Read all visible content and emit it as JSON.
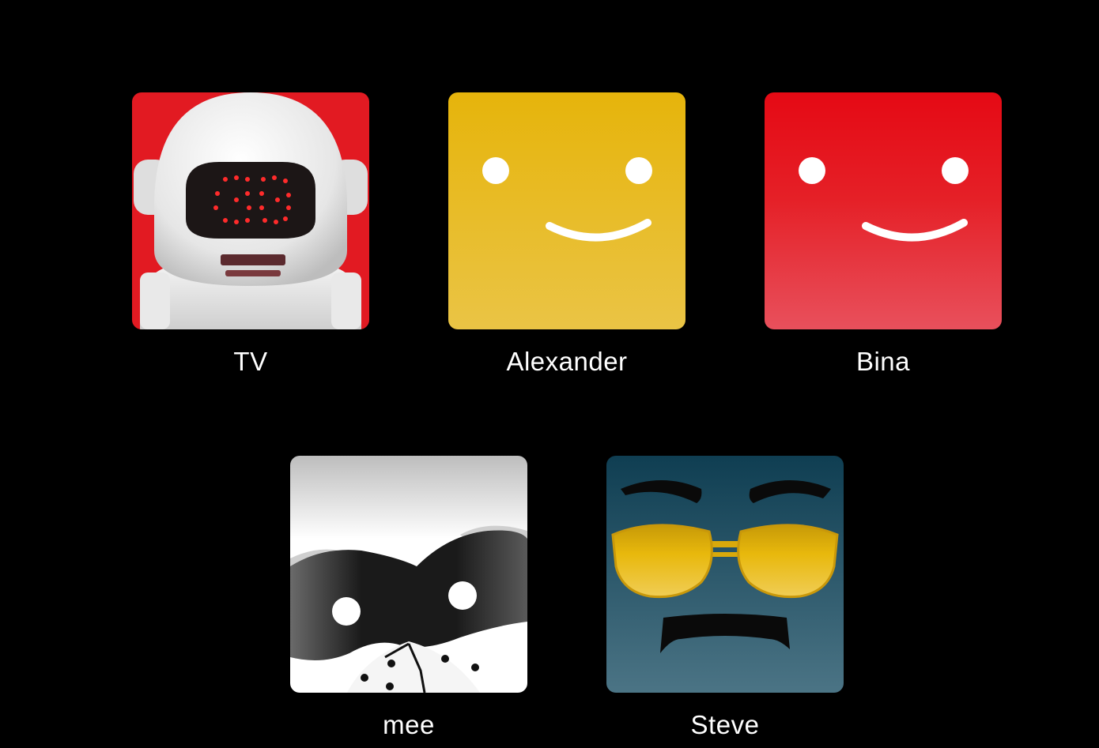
{
  "profiles": [
    {
      "name": "TV",
      "avatar": "robot-astronaut-icon",
      "background": "#E21A22"
    },
    {
      "name": "Alexander",
      "avatar": "smiley-face-icon",
      "background": "#E8B811"
    },
    {
      "name": "Bina",
      "avatar": "smiley-face-icon",
      "background": "#E50914"
    },
    {
      "name": "mee",
      "avatar": "raccoon-mask-icon",
      "background": "#F2F2F2"
    },
    {
      "name": "Steve",
      "avatar": "aviator-sunglasses-mustache-icon",
      "background": "#2E5566"
    }
  ]
}
